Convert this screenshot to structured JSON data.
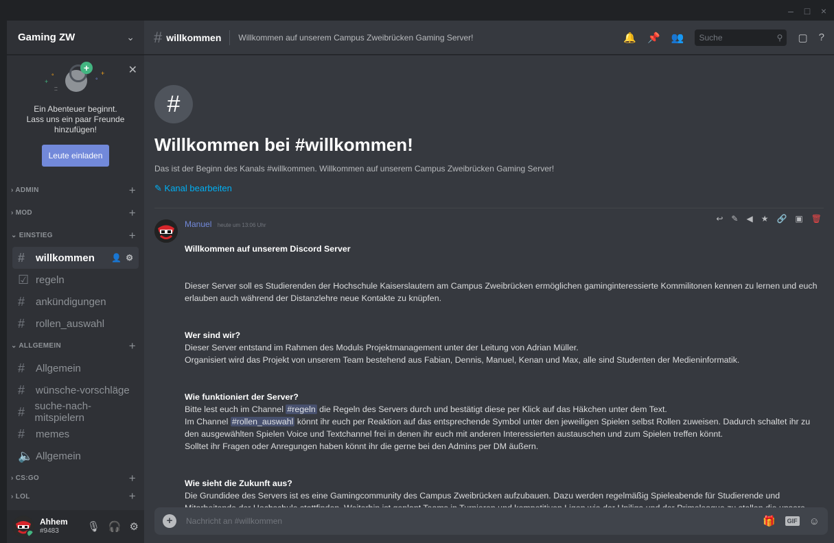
{
  "window": {
    "minimize": "–",
    "maximize": "□",
    "close": "×"
  },
  "server": {
    "name": "Gaming ZW"
  },
  "invite": {
    "text_line1": "Ein Abenteuer beginnt.",
    "text_line2": "Lass uns ein paar Freunde",
    "text_line3": "hinzufügen!",
    "button": "Leute einladen"
  },
  "categories": {
    "admin": "ADMIN",
    "mod": "MOD",
    "einstieg": "EINSTIEG",
    "allgemein": "ALLGEMEIN",
    "csgo": "CS:GO",
    "lol": "LOL"
  },
  "channels": {
    "willkommen": "willkommen",
    "regeln": "regeln",
    "ankuendigungen": "ankündigungen",
    "rollen_auswahl": "rollen_auswahl",
    "allgemein": "Allgemein",
    "wuensche": "wünsche-vorschläge",
    "suche": "suche-nach-mitspielern",
    "memes": "memes",
    "voice_allgemein": "Allgemein"
  },
  "user": {
    "name": "Ahhem",
    "tag": "#9483"
  },
  "header": {
    "channel": "willkommen",
    "topic": "Willkommen auf unserem Campus Zweibrücken Gaming Server!",
    "search_placeholder": "Suche"
  },
  "welcome": {
    "title": "Willkommen bei #willkommen!",
    "subtitle": "Das ist der Beginn des Kanals #willkommen. Willkommen auf unserem Campus Zweibrücken Gaming Server!",
    "edit": "Kanal bearbeiten"
  },
  "message": {
    "author": "Manuel",
    "timestamp": "heute um 13:06 Uhr",
    "heading": "Willkommen auf unserem Discord Server",
    "p1": "Dieser Server soll es Studierenden der Hochschule Kaiserslautern am Campus Zweibrücken ermöglichen gaminginteressierte Kommilitonen kennen zu lernen und euch erlauben auch während der Distanzlehre neue Kontakte zu knüpfen.",
    "h2": "Wer sind wir?",
    "p2": "Dieser Server entstand im Rahmen des Moduls Projektmanagement unter der Leitung von Adrian Müller.\nOrganisiert wird das Projekt von unserem Team bestehend aus Fabian, Dennis, Manuel, Kenan und Max, alle sind Studenten der Medieninformatik.",
    "h3": "Wie funktioniert der Server?",
    "p3a": "Bitte lest euch im Channel ",
    "m1": "#regeln",
    "p3b": " die Regeln des Servers durch und bestätigt diese per Klick auf das Häkchen unter dem Text.\nIm Channel ",
    "m2": "#rollen_auswahl",
    "p3c": " könnt ihr euch per Reaktion auf das entsprechende Symbol unter den jeweiligen Spielen selbst Rollen zuweisen. Dadurch schaltet ihr zu den ausgewählten Spielen Voice und Textchannel frei  in denen ihr euch mit anderen Interessierten austauschen und zum Spielen treffen könnt.\nSolltet ihr Fragen oder Anregungen haben könnt ihr die gerne bei den Admins per DM äußern.",
    "h4": "Wie sieht die Zukunft aus?",
    "p4": "Die Grundidee des Servers ist es eine Gamingcommunity des Campus Zweibrücken aufzubauen. Dazu werden regelmäßig Spieleabende für Studierende und Mitarbeitende der Hochschule stattfinden. Weiterhin ist geplant Teams in Turnieren und kompetitiven Ligen wie der Uniliga und der Primeleague zu stellen die unsere Hochschule dort repräsentieren."
  },
  "composer": {
    "placeholder": "Nachricht an #willkommen",
    "gif": "GIF"
  },
  "colors": {
    "accent": "#7289da",
    "link": "#00b0f4",
    "online": "#43b581",
    "danger": "#f04747"
  }
}
